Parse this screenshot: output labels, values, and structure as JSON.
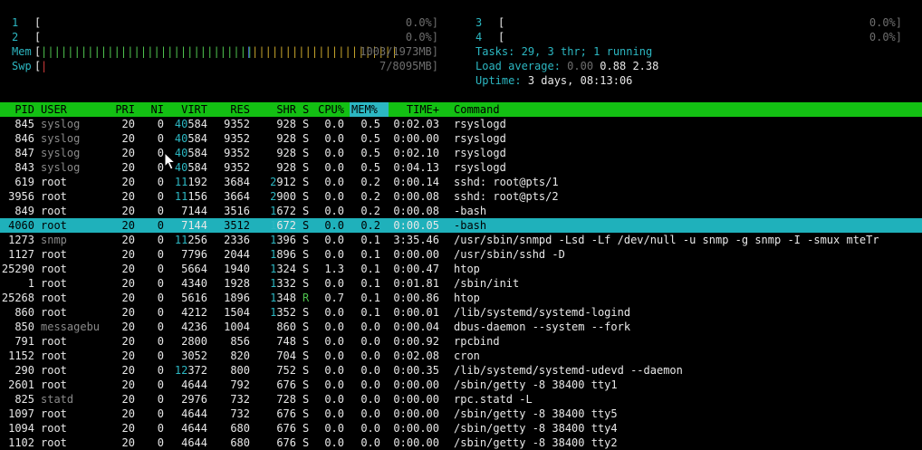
{
  "meters": {
    "cpu": [
      {
        "label": "1",
        "open": "[",
        "value": "0.0%]"
      },
      {
        "label": "2",
        "open": "[",
        "value": "0.0%]"
      },
      {
        "label": "3",
        "open": "[",
        "value": "0.0%]"
      },
      {
        "label": "4",
        "open": "[",
        "value": "0.0%]"
      }
    ],
    "mem": {
      "label": "Mem",
      "open": "[",
      "bars_green": "||||||||||||||||||||||||||||||||",
      "bars_blue": "|",
      "bars_yellow": "||||||||||||||||||||||",
      "value": "1003/1973MB]"
    },
    "swp": {
      "label": "Swp",
      "open": "[",
      "bars_red": "|",
      "value": "7/8095MB]"
    }
  },
  "info": {
    "tasks_label": "Tasks:",
    "tasks_value": "29,",
    "thr_value": "3",
    "thr_label": "thr;",
    "running_value": "1",
    "running_label": "running",
    "load_label": "Load average:",
    "load_1": "0.00",
    "load_5": "0.88",
    "load_15": "2.38",
    "uptime_label": "Uptime:",
    "uptime_value": "3 days, 08:13:06"
  },
  "table": {
    "headers": {
      "pid": "PID",
      "user": "USER",
      "pri": "PRI",
      "ni": "NI",
      "virt": "VIRT",
      "res": "RES",
      "shr": "SHR",
      "s": "S",
      "cpu": "CPU%",
      "mem": "MEM%",
      "time": "TIME+",
      "command": "Command"
    },
    "rows": [
      {
        "pid": "845",
        "user": "syslog",
        "pri": "20",
        "ni": "0",
        "virt_a": "40",
        "virt_b": "584",
        "res": "9352",
        "shr": "928",
        "s": "S",
        "cpu": "0.0",
        "mem": "0.5",
        "time_a": "0:02.",
        "time_b": "03",
        "command": "rsyslogd",
        "user_dim": true
      },
      {
        "pid": "846",
        "user": "syslog",
        "pri": "20",
        "ni": "0",
        "virt_a": "40",
        "virt_b": "584",
        "res": "9352",
        "shr": "928",
        "s": "S",
        "cpu": "0.0",
        "mem": "0.5",
        "time_a": "0:00.",
        "time_b": "00",
        "command": "rsyslogd",
        "user_dim": true
      },
      {
        "pid": "847",
        "user": "syslog",
        "pri": "20",
        "ni": "0",
        "virt_a": "40",
        "virt_b": "584",
        "res": "9352",
        "shr": "928",
        "s": "S",
        "cpu": "0.0",
        "mem": "0.5",
        "time_a": "0:02.",
        "time_b": "10",
        "command": "rsyslogd",
        "user_dim": true
      },
      {
        "pid": "843",
        "user": "syslog",
        "pri": "20",
        "ni": "0",
        "virt_a": "40",
        "virt_b": "584",
        "res": "9352",
        "shr": "928",
        "s": "S",
        "cpu": "0.0",
        "mem": "0.5",
        "time_a": "0:04.",
        "time_b": "13",
        "command": "rsyslogd",
        "user_dim": true
      },
      {
        "pid": "619",
        "user": "root",
        "pri": "20",
        "ni": "0",
        "virt_a": "11",
        "virt_b": "192",
        "res": "3684",
        "shr_a": "2",
        "shr_b": "912",
        "s": "S",
        "cpu": "0.0",
        "mem": "0.2",
        "time_a": "0:00.",
        "time_b": "14",
        "command": "sshd: root@pts/1"
      },
      {
        "pid": "3956",
        "user": "root",
        "pri": "20",
        "ni": "0",
        "virt_a": "11",
        "virt_b": "156",
        "res": "3664",
        "shr_a": "2",
        "shr_b": "900",
        "s": "S",
        "cpu": "0.0",
        "mem": "0.2",
        "time_a": "0:00.",
        "time_b": "08",
        "command": "sshd: root@pts/2"
      },
      {
        "pid": "849",
        "user": "root",
        "pri": "20",
        "ni": "0",
        "virt_a": "",
        "virt_b": "7144",
        "res": "3516",
        "shr_a": "1",
        "shr_b": "672",
        "s": "S",
        "cpu": "0.0",
        "mem": "0.2",
        "time_a": "0:00.",
        "time_b": "08",
        "command": "-bash"
      },
      {
        "pid": "4060",
        "user": "root",
        "pri": "20",
        "ni": "0",
        "virt_a": "",
        "virt_b": "7144",
        "res": "3512",
        "shr_a": "1",
        "shr_b": "672",
        "s": "S",
        "cpu": "0.0",
        "mem": "0.2",
        "time_a": "0:00.",
        "time_b": "05",
        "command": "-bash",
        "selected": true
      },
      {
        "pid": "1273",
        "user": "snmp",
        "pri": "20",
        "ni": "0",
        "virt_a": "11",
        "virt_b": "256",
        "res": "2336",
        "shr_a": "1",
        "shr_b": "396",
        "s": "S",
        "cpu": "0.0",
        "mem": "0.1",
        "time_a": "3:35.",
        "time_b": "46",
        "command": "/usr/sbin/snmpd -Lsd -Lf /dev/null -u snmp -g snmp -I -smux mteTr",
        "user_dim": true
      },
      {
        "pid": "1127",
        "user": "root",
        "pri": "20",
        "ni": "0",
        "virt_a": "",
        "virt_b": "7796",
        "res": "2044",
        "shr_a": "1",
        "shr_b": "896",
        "s": "S",
        "cpu": "0.0",
        "mem": "0.1",
        "time_a": "0:00.",
        "time_b": "00",
        "command": "/usr/sbin/sshd -D"
      },
      {
        "pid": "25290",
        "user": "root",
        "pri": "20",
        "ni": "0",
        "virt_a": "",
        "virt_b": "5664",
        "res": "1940",
        "shr_a": "1",
        "shr_b": "324",
        "s": "S",
        "cpu": "1.3",
        "mem": "0.1",
        "time_a": "0:00.",
        "time_b": "47",
        "command": "htop"
      },
      {
        "pid": "1",
        "user": "root",
        "pri": "20",
        "ni": "0",
        "virt_a": "",
        "virt_b": "4340",
        "res": "1928",
        "shr_a": "1",
        "shr_b": "332",
        "s": "S",
        "cpu": "0.0",
        "mem": "0.1",
        "time_a": "0:01.",
        "time_b": "81",
        "command": "/sbin/init"
      },
      {
        "pid": "25268",
        "user": "root",
        "pri": "20",
        "ni": "0",
        "virt_a": "",
        "virt_b": "5616",
        "res": "1896",
        "shr_a": "1",
        "shr_b": "348",
        "s": "R",
        "cpu": "0.7",
        "mem": "0.1",
        "time_a": "0:00.",
        "time_b": "86",
        "command": "htop",
        "running": true
      },
      {
        "pid": "860",
        "user": "root",
        "pri": "20",
        "ni": "0",
        "virt_a": "",
        "virt_b": "4212",
        "res": "1504",
        "shr_a": "1",
        "shr_b": "352",
        "s": "S",
        "cpu": "0.0",
        "mem": "0.1",
        "time_a": "0:00.",
        "time_b": "01",
        "command": "/lib/systemd/systemd-logind"
      },
      {
        "pid": "850",
        "user": "messagebu",
        "pri": "20",
        "ni": "0",
        "virt_a": "",
        "virt_b": "4236",
        "res": "1004",
        "shr_a": "",
        "shr_b": "860",
        "s": "S",
        "cpu": "0.0",
        "mem": "0.0",
        "time_a": "0:00.",
        "time_b": "04",
        "command": "dbus-daemon --system --fork",
        "user_dim": true
      },
      {
        "pid": "791",
        "user": "root",
        "pri": "20",
        "ni": "0",
        "virt_a": "",
        "virt_b": "2800",
        "res": "856",
        "shr_a": "",
        "shr_b": "748",
        "s": "S",
        "cpu": "0.0",
        "mem": "0.0",
        "time_a": "0:00.",
        "time_b": "92",
        "command": "rpcbind"
      },
      {
        "pid": "1152",
        "user": "root",
        "pri": "20",
        "ni": "0",
        "virt_a": "",
        "virt_b": "3052",
        "res": "820",
        "shr_a": "",
        "shr_b": "704",
        "s": "S",
        "cpu": "0.0",
        "mem": "0.0",
        "time_a": "0:02.",
        "time_b": "08",
        "command": "cron"
      },
      {
        "pid": "290",
        "user": "root",
        "pri": "20",
        "ni": "0",
        "virt_a": "12",
        "virt_b": "372",
        "res": "800",
        "shr_a": "",
        "shr_b": "752",
        "s": "S",
        "cpu": "0.0",
        "mem": "0.0",
        "time_a": "0:00.",
        "time_b": "35",
        "command": "/lib/systemd/systemd-udevd --daemon"
      },
      {
        "pid": "2601",
        "user": "root",
        "pri": "20",
        "ni": "0",
        "virt_a": "",
        "virt_b": "4644",
        "res": "792",
        "shr_a": "",
        "shr_b": "676",
        "s": "S",
        "cpu": "0.0",
        "mem": "0.0",
        "time_a": "0:00.",
        "time_b": "00",
        "command": "/sbin/getty -8 38400 tty1"
      },
      {
        "pid": "825",
        "user": "statd",
        "pri": "20",
        "ni": "0",
        "virt_a": "",
        "virt_b": "2976",
        "res": "732",
        "shr_a": "",
        "shr_b": "728",
        "s": "S",
        "cpu": "0.0",
        "mem": "0.0",
        "time_a": "0:00.",
        "time_b": "00",
        "command": "rpc.statd -L",
        "user_dim": true
      },
      {
        "pid": "1097",
        "user": "root",
        "pri": "20",
        "ni": "0",
        "virt_a": "",
        "virt_b": "4644",
        "res": "732",
        "shr_a": "",
        "shr_b": "676",
        "s": "S",
        "cpu": "0.0",
        "mem": "0.0",
        "time_a": "0:00.",
        "time_b": "00",
        "command": "/sbin/getty -8 38400 tty5"
      },
      {
        "pid": "1094",
        "user": "root",
        "pri": "20",
        "ni": "0",
        "virt_a": "",
        "virt_b": "4644",
        "res": "680",
        "shr_a": "",
        "shr_b": "676",
        "s": "S",
        "cpu": "0.0",
        "mem": "0.0",
        "time_a": "0:00.",
        "time_b": "00",
        "command": "/sbin/getty -8 38400 tty4"
      },
      {
        "pid": "1102",
        "user": "root",
        "pri": "20",
        "ni": "0",
        "virt_a": "",
        "virt_b": "4644",
        "res": "680",
        "shr_a": "",
        "shr_b": "676",
        "s": "S",
        "cpu": "0.0",
        "mem": "0.0",
        "time_a": "0:00.",
        "time_b": "00",
        "command": "/sbin/getty -8 38400 tty2"
      }
    ]
  },
  "colors": {
    "header_bg": "#13c013",
    "sorted_col_bg": "#2cb7c2",
    "selected_row_bg": "#1fb1bb",
    "cyan": "#2cb7c2",
    "green": "#4ec24e",
    "red": "#d23a3a",
    "blue": "#4563d6",
    "yellow": "#c4a22a"
  },
  "icons": {
    "pointer": "mouse-pointer-icon"
  }
}
